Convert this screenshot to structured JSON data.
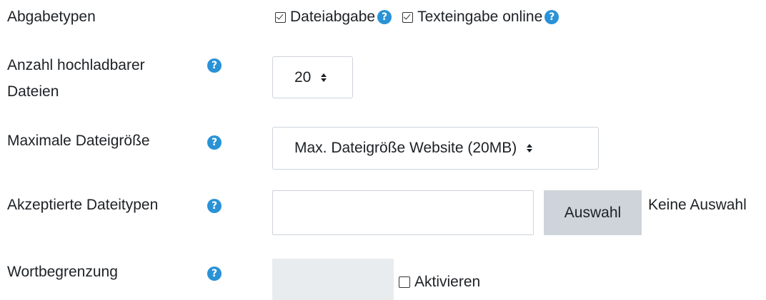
{
  "rows": {
    "abgabetypen": {
      "label": "Abgabetypen",
      "options": [
        {
          "label": "Dateiabgabe",
          "checked": true
        },
        {
          "label": "Texteingabe online",
          "checked": true
        }
      ]
    },
    "anzahl": {
      "label_line1": "Anzahl hochladbarer",
      "label_line2": "Dateien",
      "value": "20"
    },
    "max_size": {
      "label": "Maximale Dateigröße",
      "value": "Max. Dateigröße Website (20MB)"
    },
    "dateitypen": {
      "label": "Akzeptierte Dateitypen",
      "input_value": "",
      "button_label": "Auswahl",
      "status_text": "Keine Auswahl"
    },
    "wortbegrenzung": {
      "label": "Wortbegrenzung",
      "input_value": "",
      "checkbox_label": "Aktivieren",
      "checked": false
    }
  },
  "help_glyph": "?",
  "colors": {
    "help_icon": "#2a92d6",
    "button_bg": "#ced4da",
    "disabled_bg": "#e9ecef",
    "text": "#1d2125"
  },
  "icons": [
    "help-icon",
    "checkbox-icon",
    "updown-arrows-icon"
  ]
}
